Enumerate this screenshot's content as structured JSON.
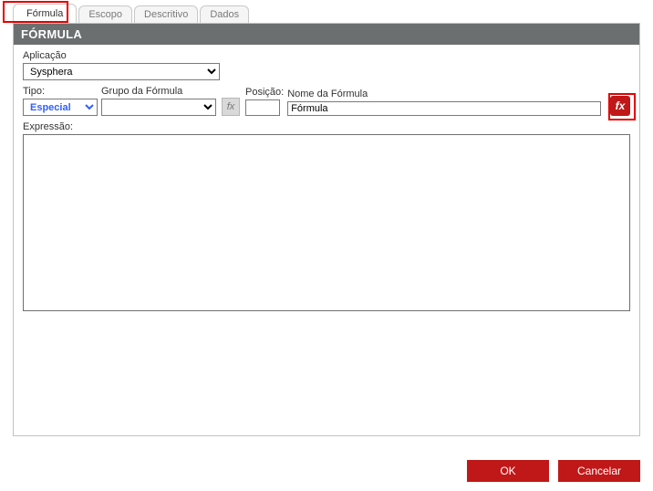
{
  "tabs": {
    "formula": "Fórmula",
    "escopo": "Escopo",
    "descritivo": "Descritivo",
    "dados": "Dados"
  },
  "panel": {
    "title": "FÓRMULA"
  },
  "labels": {
    "aplicacao": "Aplicação",
    "tipo": "Tipo:",
    "grupo": "Grupo da Fórmula",
    "posicao": "Posição:",
    "nome": "Nome da Fórmula",
    "expressao": "Expressão:"
  },
  "values": {
    "aplicacao": "Sysphera",
    "tipo": "Especial",
    "grupo": "",
    "posicao": "",
    "nome": "Fórmula",
    "expressao": ""
  },
  "icons": {
    "fx_small": "fx",
    "fx_button": "fx"
  },
  "buttons": {
    "ok": "OK",
    "cancel": "Cancelar"
  }
}
